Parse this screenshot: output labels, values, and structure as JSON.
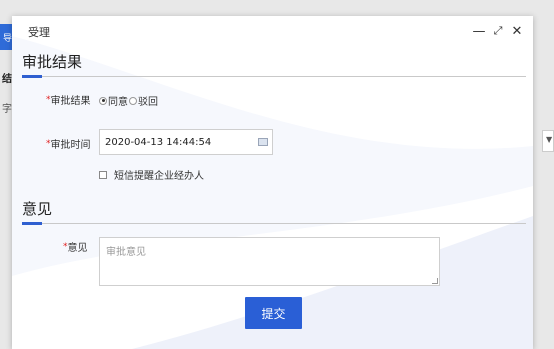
{
  "background": {
    "strip_text": "导",
    "text_a": "结",
    "text_b": "字",
    "right_box_text": "▼"
  },
  "modal": {
    "title": "受理",
    "controls": {
      "minimize": "—",
      "maximize": "⤢",
      "close": "✕"
    }
  },
  "sections": {
    "approval_title": "审批结果",
    "opinion_title": "意见"
  },
  "form": {
    "result": {
      "required_mark": "*",
      "label": "审批结果",
      "options": [
        {
          "label": "同意",
          "checked": true
        },
        {
          "label": "驳回",
          "checked": false
        }
      ]
    },
    "time": {
      "required_mark": "*",
      "label": "审批时间",
      "value": "2020-04-13 14:44:54"
    },
    "sms": {
      "label": "短信提醒企业经办人",
      "checked": false
    },
    "opinion": {
      "required_mark": "*",
      "label": "意见",
      "placeholder": "审批意见"
    },
    "submit_label": "提交"
  },
  "colors": {
    "accent": "#2a5fd6",
    "required": "#e02020"
  }
}
